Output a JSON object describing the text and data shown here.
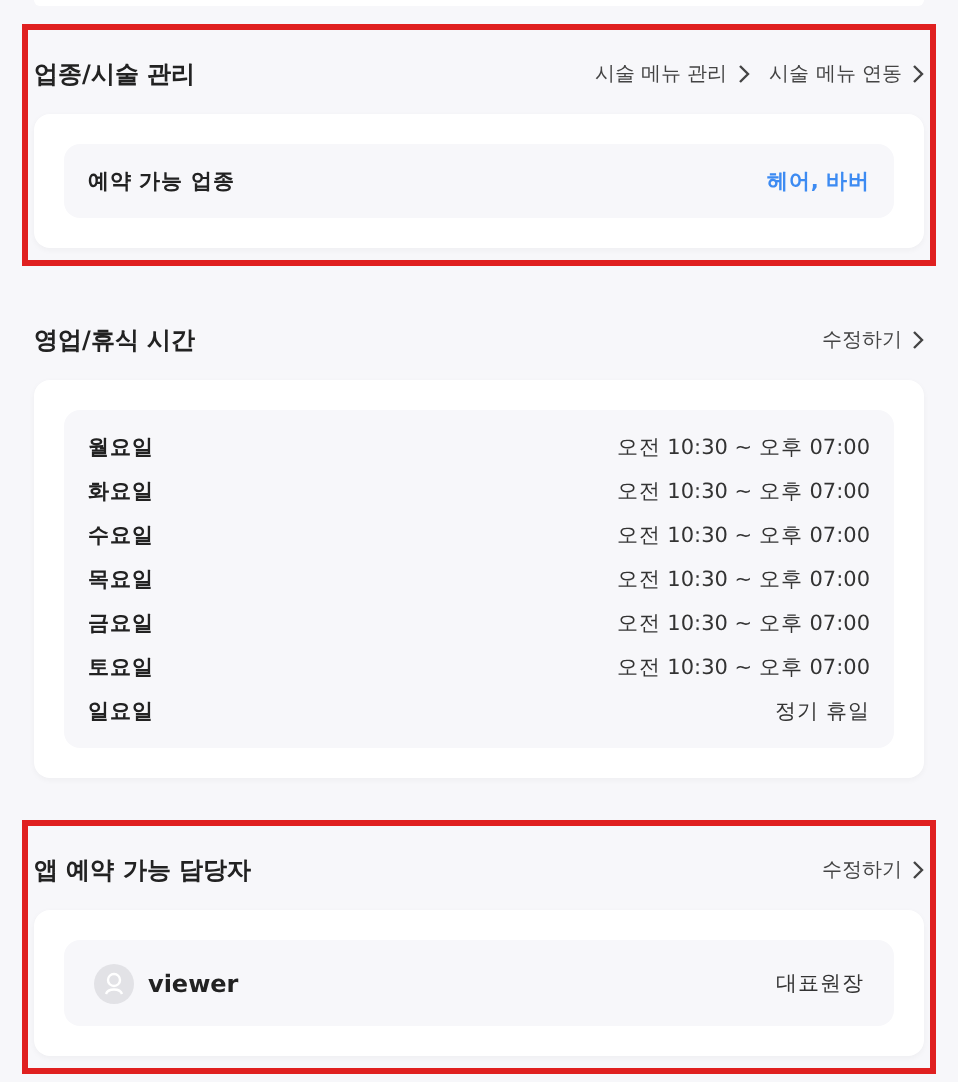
{
  "sections": [
    {
      "title": "업종/시술 관리",
      "highlighted": true,
      "links": [
        "시술 메뉴 관리",
        "시술 메뉴 연동"
      ],
      "kind": "pairs",
      "rows": [
        {
          "label": "예약 가능 업종",
          "value": "헤어, 바버",
          "accent": true
        }
      ]
    },
    {
      "title": "영업/휴식 시간",
      "highlighted": false,
      "links": [
        "수정하기"
      ],
      "kind": "pairs",
      "rows": [
        {
          "label": "월요일",
          "value": "오전 10:30 ~ 오후 07:00",
          "accent": false
        },
        {
          "label": "화요일",
          "value": "오전 10:30 ~ 오후 07:00",
          "accent": false
        },
        {
          "label": "수요일",
          "value": "오전 10:30 ~ 오후 07:00",
          "accent": false
        },
        {
          "label": "목요일",
          "value": "오전 10:30 ~ 오후 07:00",
          "accent": false
        },
        {
          "label": "금요일",
          "value": "오전 10:30 ~ 오후 07:00",
          "accent": false
        },
        {
          "label": "토요일",
          "value": "오전 10:30 ~ 오후 07:00",
          "accent": false
        },
        {
          "label": "일요일",
          "value": "정기 휴일",
          "accent": false
        }
      ]
    },
    {
      "title": "앱 예약 가능 담당자",
      "highlighted": true,
      "links": [
        "수정하기"
      ],
      "kind": "staff",
      "rows": [
        {
          "label": "viewer",
          "value": "대표원장",
          "accent": false
        }
      ]
    }
  ]
}
